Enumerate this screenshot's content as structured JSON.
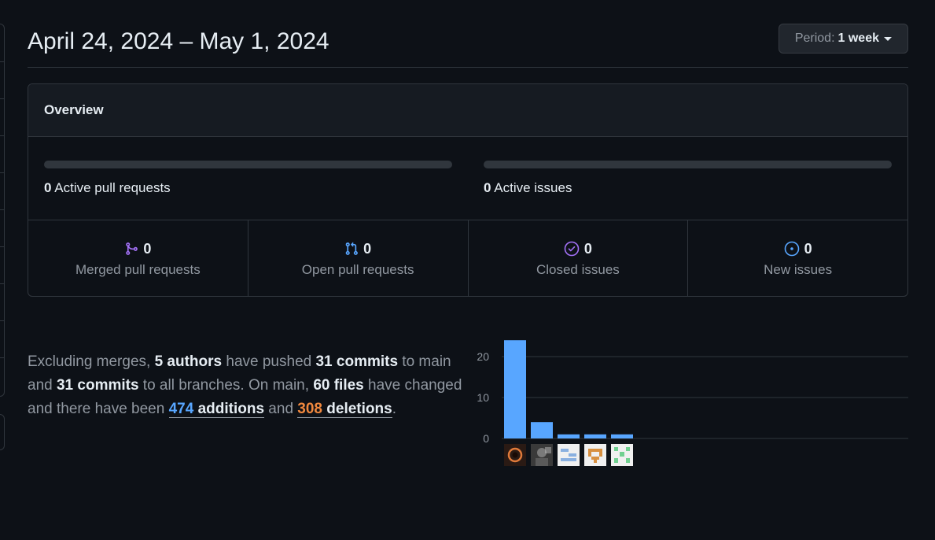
{
  "header": {
    "title": "April 24, 2024 – May 1, 2024",
    "period_label": "Period:",
    "period_value": "1 week"
  },
  "overview": {
    "heading": "Overview",
    "active_prs_count": "0",
    "active_prs_label": "Active pull requests",
    "active_issues_count": "0",
    "active_issues_label": "Active issues",
    "active_prs_fraction": 0,
    "active_issues_fraction": 0,
    "stats": [
      {
        "count": "0",
        "label": "Merged pull requests",
        "icon": "git-merge-icon",
        "color": "#a371f7"
      },
      {
        "count": "0",
        "label": "Open pull requests",
        "icon": "git-pull-request-icon",
        "color": "#58a6ff"
      },
      {
        "count": "0",
        "label": "Closed issues",
        "icon": "issue-closed-icon",
        "color": "#a371f7"
      },
      {
        "count": "0",
        "label": "New issues",
        "icon": "issue-opened-icon",
        "color": "#58a6ff"
      }
    ]
  },
  "summary": {
    "t1": "Excluding merges, ",
    "authors": "5 authors",
    "t2": " have pushed ",
    "commits_main": "31 commits",
    "t3": " to main and ",
    "commits_all": "31 commits",
    "t4": " to all branches. On main, ",
    "files": "60 files",
    "t5": " have changed and there have been ",
    "additions_num": "474",
    "additions_word": " additions",
    "t6": " and ",
    "deletions_num": "308",
    "deletions_word": " deletions",
    "t7": "."
  },
  "chart_data": {
    "type": "bar",
    "categories": [
      "author-1",
      "author-2",
      "author-3",
      "author-4",
      "author-5"
    ],
    "values": [
      24,
      4,
      1,
      1,
      1
    ],
    "ylim": [
      0,
      25
    ],
    "yticks": [
      0,
      10,
      20
    ],
    "bar_color": "#58a6ff",
    "grid": true
  },
  "avatars": [
    {
      "icon": "avatar-eye-icon",
      "bg": "#2a1a14",
      "fg": "#e07a3a"
    },
    {
      "icon": "avatar-photo-icon",
      "bg": "#3a3a3a",
      "fg": "#bbbbbb"
    },
    {
      "icon": "identicon-blue-icon",
      "bg": "#f0f0f0",
      "fg": "#8ab0e0"
    },
    {
      "icon": "identicon-orange-icon",
      "bg": "#f0f0f0",
      "fg": "#d89040"
    },
    {
      "icon": "identicon-green-icon",
      "bg": "#f0f0f0",
      "fg": "#70d090"
    }
  ]
}
